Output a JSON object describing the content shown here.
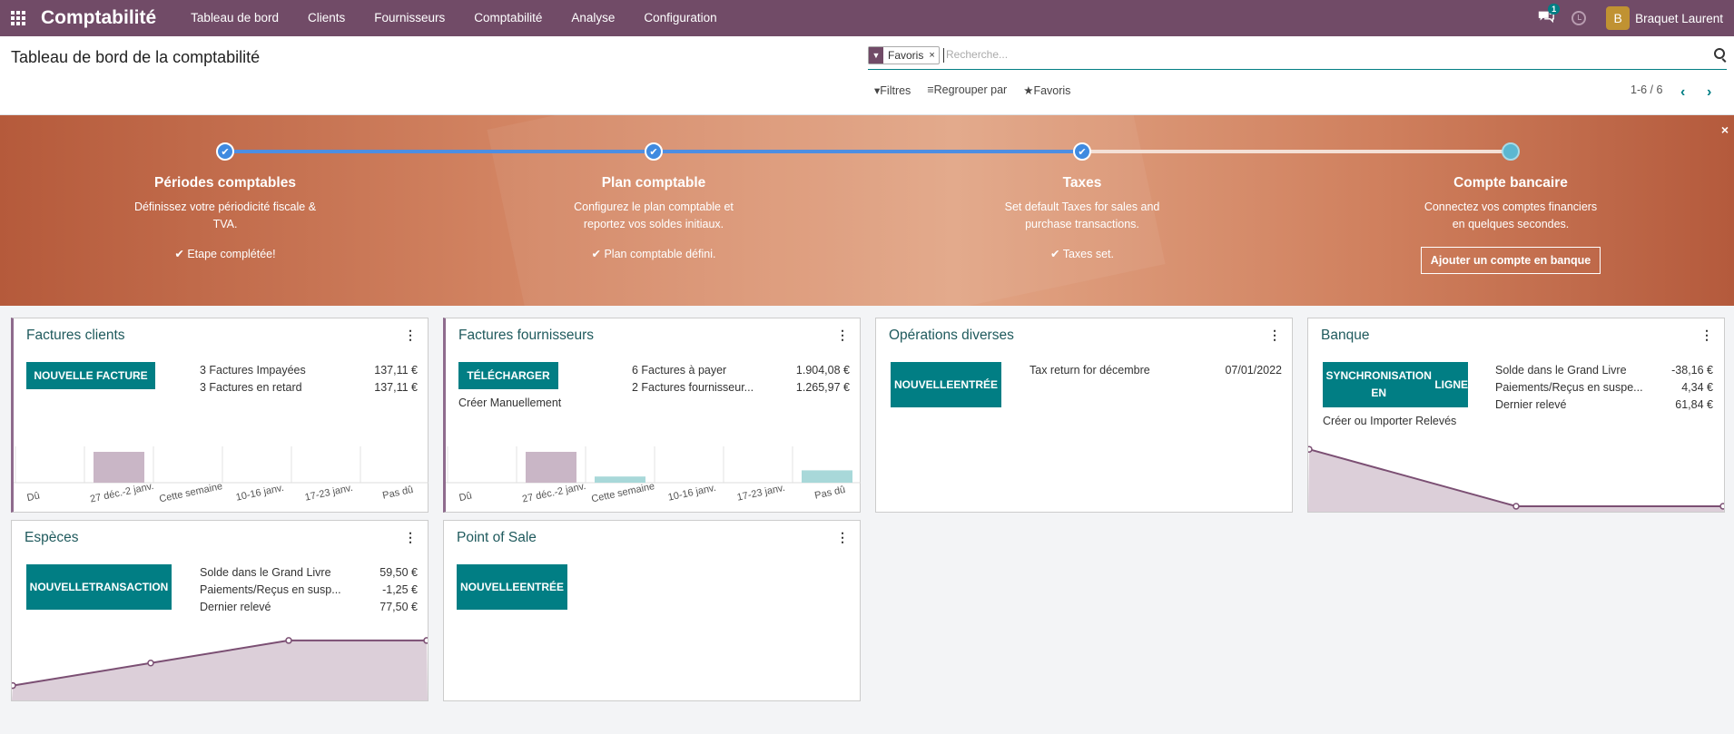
{
  "topbar": {
    "app": "Comptabilité",
    "menu": [
      "Tableau de bord",
      "Clients",
      "Fournisseurs",
      "Comptabilité",
      "Analyse",
      "Configuration"
    ],
    "chat_count": "1",
    "avatar_letter": "B",
    "user": "Braquet Laurent"
  },
  "control": {
    "title": "Tableau de bord de la comptabilité",
    "facet": "Favoris",
    "facet_remove": "×",
    "search_placeholder": "Recherche...",
    "filters": "Filtres",
    "group_by": "Regrouper par",
    "favorites": "Favoris",
    "pager": "1-6 / 6"
  },
  "onboarding": {
    "close": "×",
    "steps": [
      {
        "title": "Périodes comptables",
        "desc1": "Définissez votre périodicité fiscale &",
        "desc2": "TVA.",
        "status": "✔ Etape complétée!"
      },
      {
        "title": "Plan comptable",
        "desc1": "Configurez le plan comptable et",
        "desc2": "reportez vos soldes initiaux.",
        "status": "✔ Plan comptable défini."
      },
      {
        "title": "Taxes",
        "desc1": "Set default Taxes for sales and",
        "desc2": "purchase transactions.",
        "status": "✔ Taxes set."
      },
      {
        "title": "Compte bancaire",
        "desc1": "Connectez vos comptes financiers",
        "desc2": "en quelques secondes.",
        "button": "Ajouter un compte en banque"
      }
    ]
  },
  "cards": {
    "sales": {
      "title": "Factures clients",
      "button": "NOUVELLE FACTURE",
      "rows": [
        {
          "label": "3 Factures Impayées",
          "value": "137,11 €"
        },
        {
          "label": "3 Factures en retard",
          "value": "137,11 €"
        }
      ]
    },
    "purchase": {
      "title": "Factures fournisseurs",
      "button": "TÉLÉCHARGER",
      "link": "Créer Manuellement",
      "rows": [
        {
          "label": "6 Factures à payer",
          "value": "1.904,08 €"
        },
        {
          "label": "2 Factures fournisseur...",
          "value": "1.265,97 €"
        }
      ]
    },
    "misc": {
      "title": "Opérations diverses",
      "button_l1": "NOUVELLE",
      "button_l2": "ENTRÉE",
      "rows": [
        {
          "label": "Tax return for décembre",
          "value": "07/01/2022"
        }
      ]
    },
    "bank": {
      "title": "Banque",
      "button_l1": "SYNCHRONISATION EN",
      "button_l2": "LIGNE",
      "link": "Créer ou Importer Relevés",
      "rows": [
        {
          "label": "Solde dans le Grand Livre",
          "value": "-38,16 €"
        },
        {
          "label": "Paiements/Reçus en suspe...",
          "value": "4,34 €"
        },
        {
          "label": "Dernier relevé",
          "value": "61,84 €"
        }
      ]
    },
    "cash": {
      "title": "Espèces",
      "button_l1": "NOUVELLE",
      "button_l2": "TRANSACTION",
      "rows": [
        {
          "label": "Solde dans le Grand Livre",
          "value": "59,50 €"
        },
        {
          "label": "Paiements/Reçus en susp...",
          "value": "-1,25 €"
        },
        {
          "label": "Dernier relevé",
          "value": "77,50 €"
        }
      ]
    },
    "pos": {
      "title": "Point of Sale",
      "button_l1": "NOUVELLE",
      "button_l2": "ENTRÉE"
    }
  },
  "chart_data": [
    {
      "type": "bar",
      "title": "Factures clients",
      "categories": [
        "Dû",
        "27 déc.-2 janv.",
        "Cette semaine",
        "10-16 janv.",
        "17-23 janv.",
        "Pas dû"
      ],
      "values": [
        0,
        137.11,
        0,
        0,
        0,
        0
      ],
      "colors": {
        "past": "#c9b6c6",
        "future": "#a8d8d9"
      }
    },
    {
      "type": "bar",
      "title": "Factures fournisseurs",
      "categories": [
        "Dû",
        "27 déc.-2 janv.",
        "Cette semaine",
        "10-16 janv.",
        "17-23 janv.",
        "Pas dû"
      ],
      "values": [
        0,
        1000,
        200,
        0,
        0,
        400
      ],
      "colors": {
        "past": "#c9b6c6",
        "future": "#a8d8d9"
      }
    },
    {
      "type": "area",
      "title": "Banque",
      "values": [
        61.84,
        0,
        0
      ]
    },
    {
      "type": "area",
      "title": "Espèces",
      "values": [
        10,
        30,
        50,
        50
      ]
    }
  ]
}
